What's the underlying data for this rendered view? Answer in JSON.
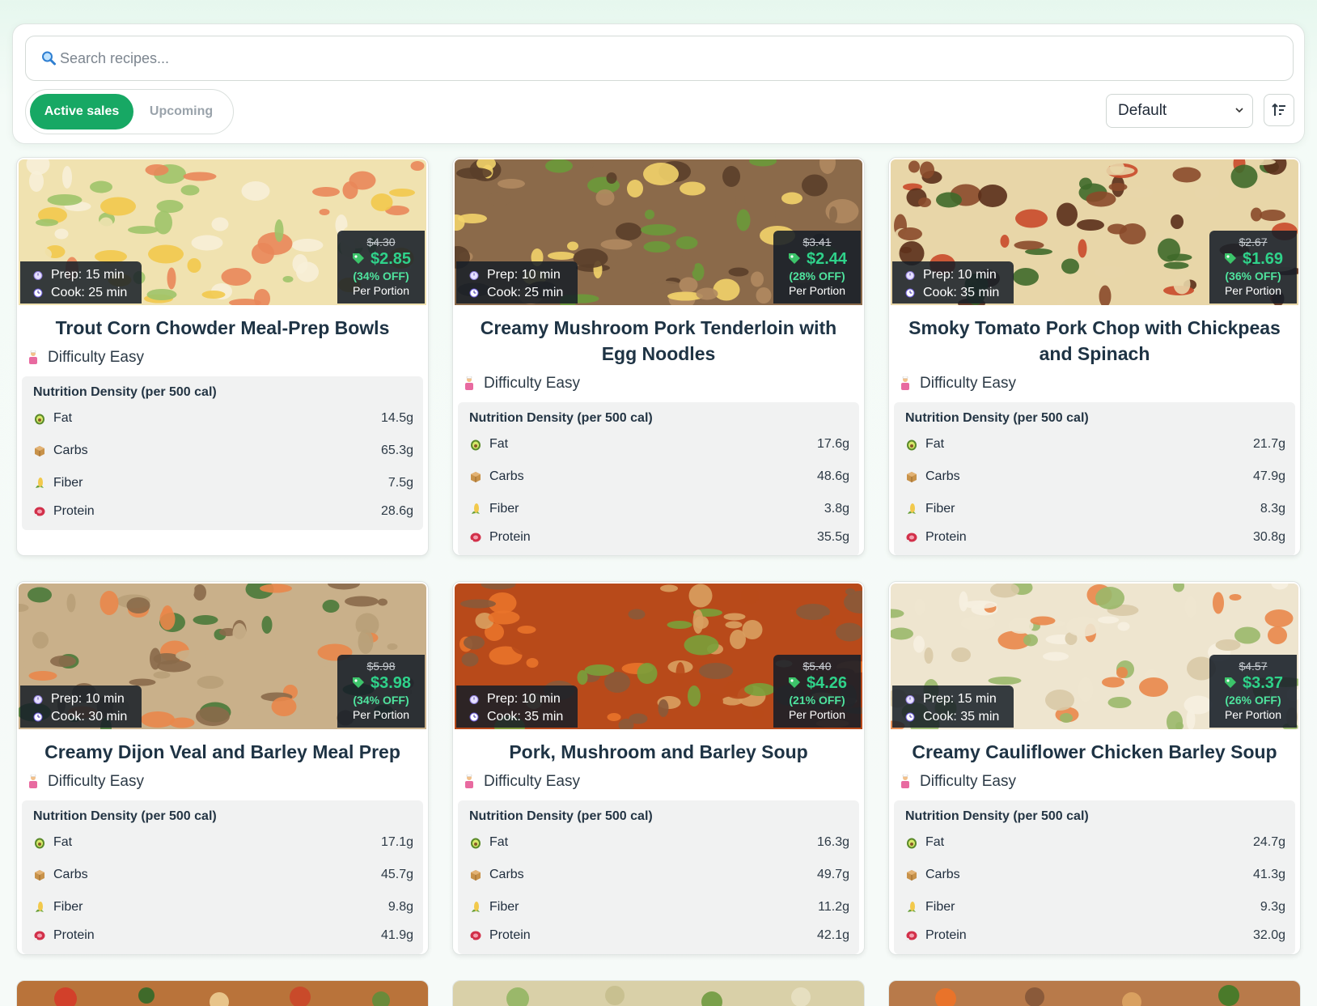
{
  "search": {
    "placeholder": "Search recipes..."
  },
  "tabs": [
    {
      "label": "Active sales",
      "active": true
    },
    {
      "label": "Upcoming",
      "active": false
    }
  ],
  "sort": {
    "selected": "Default"
  },
  "labels": {
    "prep": "Prep:",
    "cook": "Cook:",
    "per_portion": "Per Portion",
    "difficulty": "Difficulty",
    "nutrition_title": "Nutrition Density (per 500 cal)",
    "fat": "Fat",
    "carbs": "Carbs",
    "fiber": "Fiber",
    "protein": "Protein"
  },
  "colors": {
    "accent": "#17a864",
    "price": "#2fd28a"
  },
  "recipes": [
    {
      "title": "Trout Corn Chowder Meal-Prep Bowls",
      "prep": "15 min",
      "cook": "25 min",
      "old_price": "$4.30",
      "new_price": "$2.85",
      "off": "(34% OFF)",
      "difficulty": "Easy",
      "fat": "14.5g",
      "carbs": "65.3g",
      "fiber": "7.5g",
      "protein": "28.6g",
      "palette": [
        "#f0e2b0",
        "#e9875a",
        "#f2c94c",
        "#9fc46a",
        "#f7f0d8"
      ]
    },
    {
      "title": "Creamy Mushroom Pork Tenderloin with Egg Noodles",
      "prep": "10 min",
      "cook": "25 min",
      "old_price": "$3.41",
      "new_price": "$2.44",
      "off": "(28% OFF)",
      "difficulty": "Easy",
      "fat": "17.6g",
      "carbs": "48.6g",
      "fiber": "3.8g",
      "protein": "35.5g",
      "palette": [
        "#8b6a4a",
        "#b08a60",
        "#6a9a3a",
        "#f2d36a",
        "#5a3f2a"
      ]
    },
    {
      "title": "Smoky Tomato Pork Chop with Chickpeas and Spinach",
      "prep": "10 min",
      "cook": "35 min",
      "old_price": "$2.67",
      "new_price": "$1.69",
      "off": "(36% OFF)",
      "difficulty": "Easy",
      "fat": "21.7g",
      "carbs": "47.9g",
      "fiber": "8.3g",
      "protein": "30.8g",
      "palette": [
        "#e8d6a8",
        "#8a4a2a",
        "#c94a2a",
        "#3f6a2a",
        "#5a2f1a"
      ]
    },
    {
      "title": "Creamy Dijon Veal and Barley Meal Prep",
      "prep": "10 min",
      "cook": "30 min",
      "old_price": "$5.98",
      "new_price": "$3.98",
      "off": "(34% OFF)",
      "difficulty": "Easy",
      "fat": "17.1g",
      "carbs": "45.7g",
      "fiber": "9.8g",
      "protein": "41.9g",
      "palette": [
        "#c9b08a",
        "#4a7a3a",
        "#e9874a",
        "#b8a078",
        "#8a6a4a"
      ]
    },
    {
      "title": "Pork, Mushroom and Barley Soup",
      "prep": "10 min",
      "cook": "35 min",
      "old_price": "$5.40",
      "new_price": "$4.26",
      "off": "(21% OFF)",
      "difficulty": "Easy",
      "fat": "16.3g",
      "carbs": "49.7g",
      "fiber": "11.2g",
      "protein": "42.1g",
      "palette": [
        "#b84a1a",
        "#e9732a",
        "#7aa03a",
        "#8a5a3a",
        "#d9a060"
      ]
    },
    {
      "title": "Creamy Cauliflower Chicken Barley Soup",
      "prep": "15 min",
      "cook": "35 min",
      "old_price": "$4.57",
      "new_price": "$3.37",
      "off": "(26% OFF)",
      "difficulty": "Easy",
      "fat": "24.7g",
      "carbs": "41.3g",
      "fiber": "9.3g",
      "protein": "32.0g",
      "palette": [
        "#eee5cf",
        "#e9874a",
        "#d8c9a6",
        "#9ab86a",
        "#f6f0e0"
      ]
    }
  ]
}
